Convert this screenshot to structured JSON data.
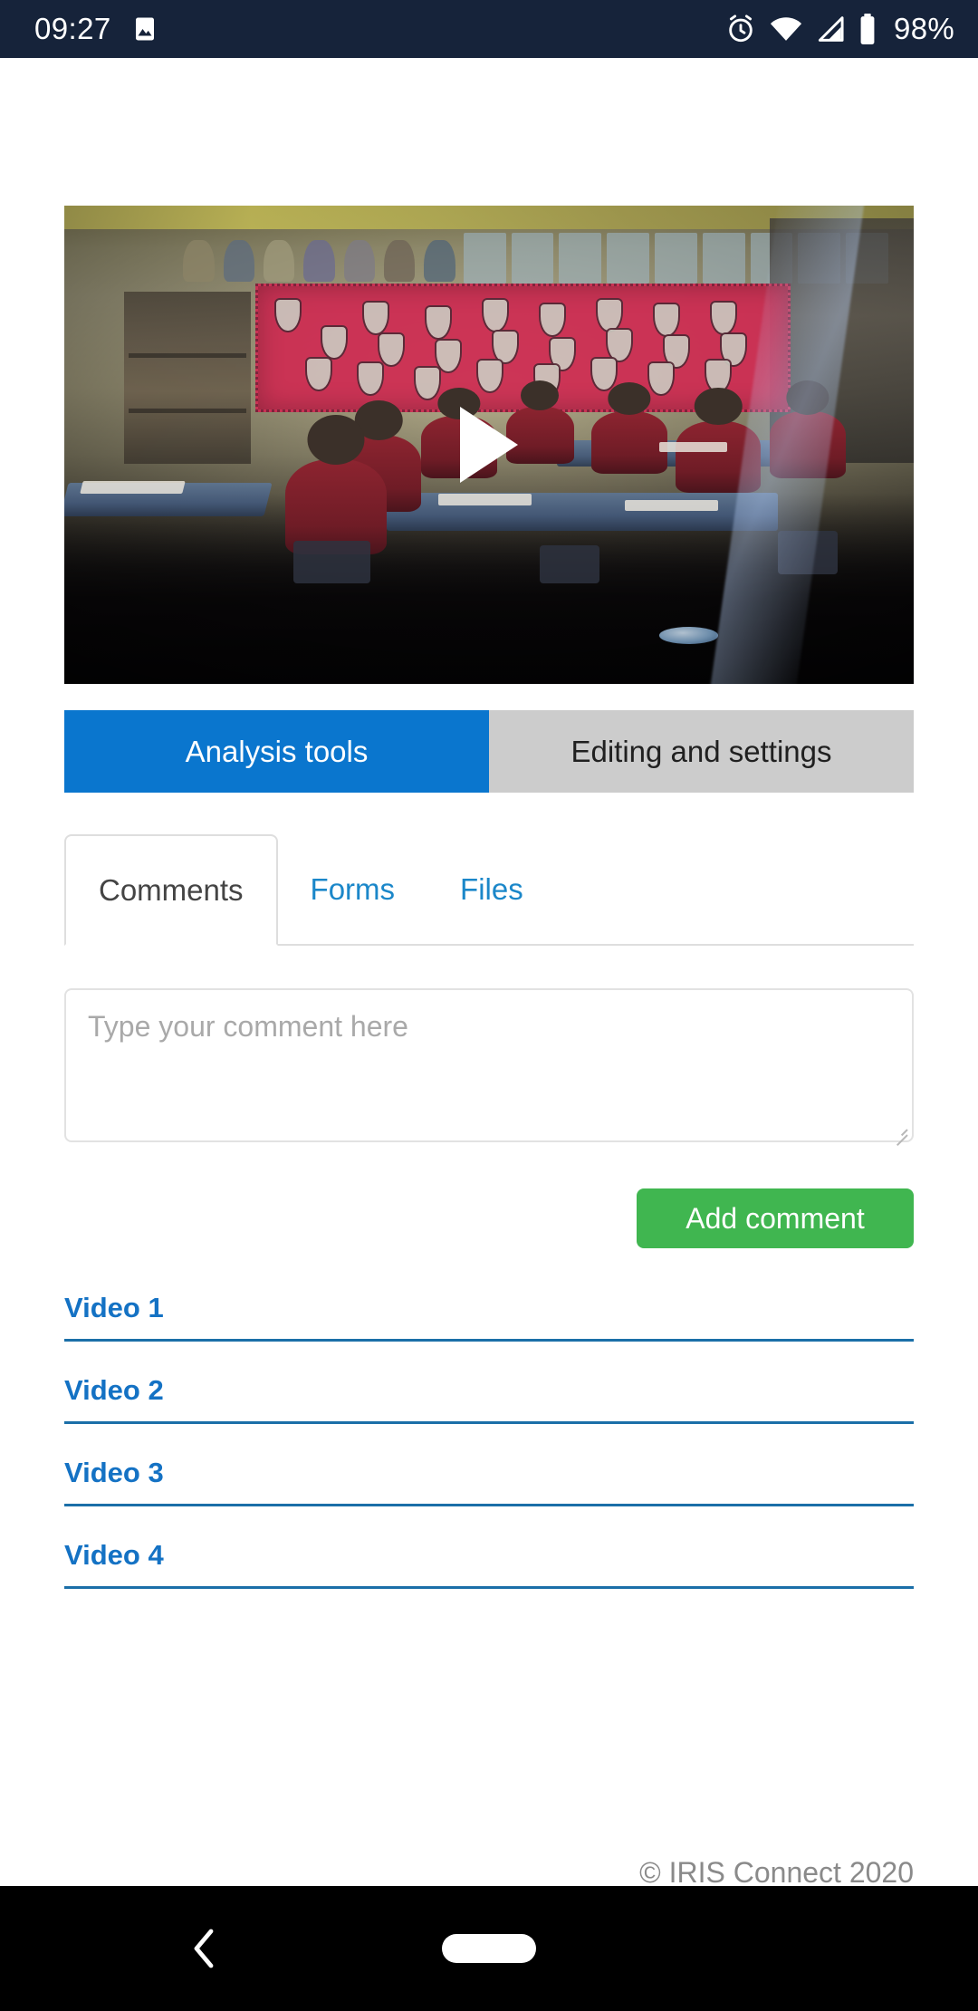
{
  "status_bar": {
    "time": "09:27",
    "battery_percent": "98%",
    "icons": {
      "gallery": "image-icon",
      "alarm": "alarm-clock-icon",
      "wifi": "wifi-icon",
      "signal": "cell-signal-icon",
      "battery": "battery-icon"
    },
    "background_color": "#16233a"
  },
  "video_player": {
    "play_icon": "play-triangle-icon",
    "scene_description": "classroom"
  },
  "main_tabs": [
    {
      "label": "Analysis tools",
      "active": true
    },
    {
      "label": "Editing and settings",
      "active": false
    }
  ],
  "sub_tabs": [
    {
      "label": "Comments",
      "active": true
    },
    {
      "label": "Forms",
      "active": false
    },
    {
      "label": "Files",
      "active": false
    }
  ],
  "comment_form": {
    "placeholder": "Type your comment here",
    "value": "",
    "submit_label": "Add comment"
  },
  "video_list": [
    {
      "label": "Video 1"
    },
    {
      "label": "Video 2"
    },
    {
      "label": "Video 3"
    },
    {
      "label": "Video 4"
    }
  ],
  "footer": {
    "copyright": "© IRIS Connect 2020"
  },
  "nav_bar": {
    "back_icon": "back-chevron-icon",
    "home_icon": "home-pill-icon"
  },
  "colors": {
    "accent_blue": "#0a76ce",
    "link_blue": "#1472c4",
    "tab_gray": "#cccccc",
    "success_green": "#40b650",
    "status_navy": "#16233a",
    "underline_blue": "#1b6fa8"
  }
}
